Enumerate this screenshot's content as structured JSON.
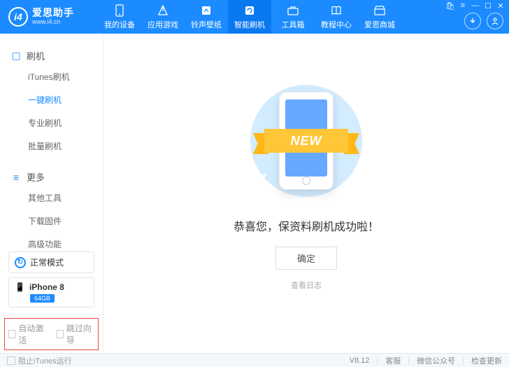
{
  "app": {
    "title": "爱思助手",
    "url": "www.i4.cn"
  },
  "nav": [
    {
      "label": "我的设备"
    },
    {
      "label": "应用游戏"
    },
    {
      "label": "铃声壁纸"
    },
    {
      "label": "智能刷机"
    },
    {
      "label": "工具箱"
    },
    {
      "label": "教程中心"
    },
    {
      "label": "爱思商城"
    }
  ],
  "sidebar": {
    "group1": {
      "title": "刷机",
      "items": [
        "iTunes刷机",
        "一键刷机",
        "专业刷机",
        "批量刷机"
      ]
    },
    "group2": {
      "title": "更多",
      "items": [
        "其他工具",
        "下载固件",
        "高级功能"
      ]
    }
  },
  "mode": {
    "label": "正常模式"
  },
  "device": {
    "name": "iPhone 8",
    "storage": "64GB"
  },
  "options": {
    "auto_activate": "自动激活",
    "skip_guide": "跳过向导"
  },
  "main": {
    "ribbon": "NEW",
    "message": "恭喜您，保资料刷机成功啦！",
    "ok": "确定",
    "view_log": "查看日志"
  },
  "status": {
    "block_itunes": "阻止iTunes运行",
    "version": "V8.12",
    "cs": "客服",
    "wechat": "微信公众号",
    "check_update": "检查更新"
  }
}
